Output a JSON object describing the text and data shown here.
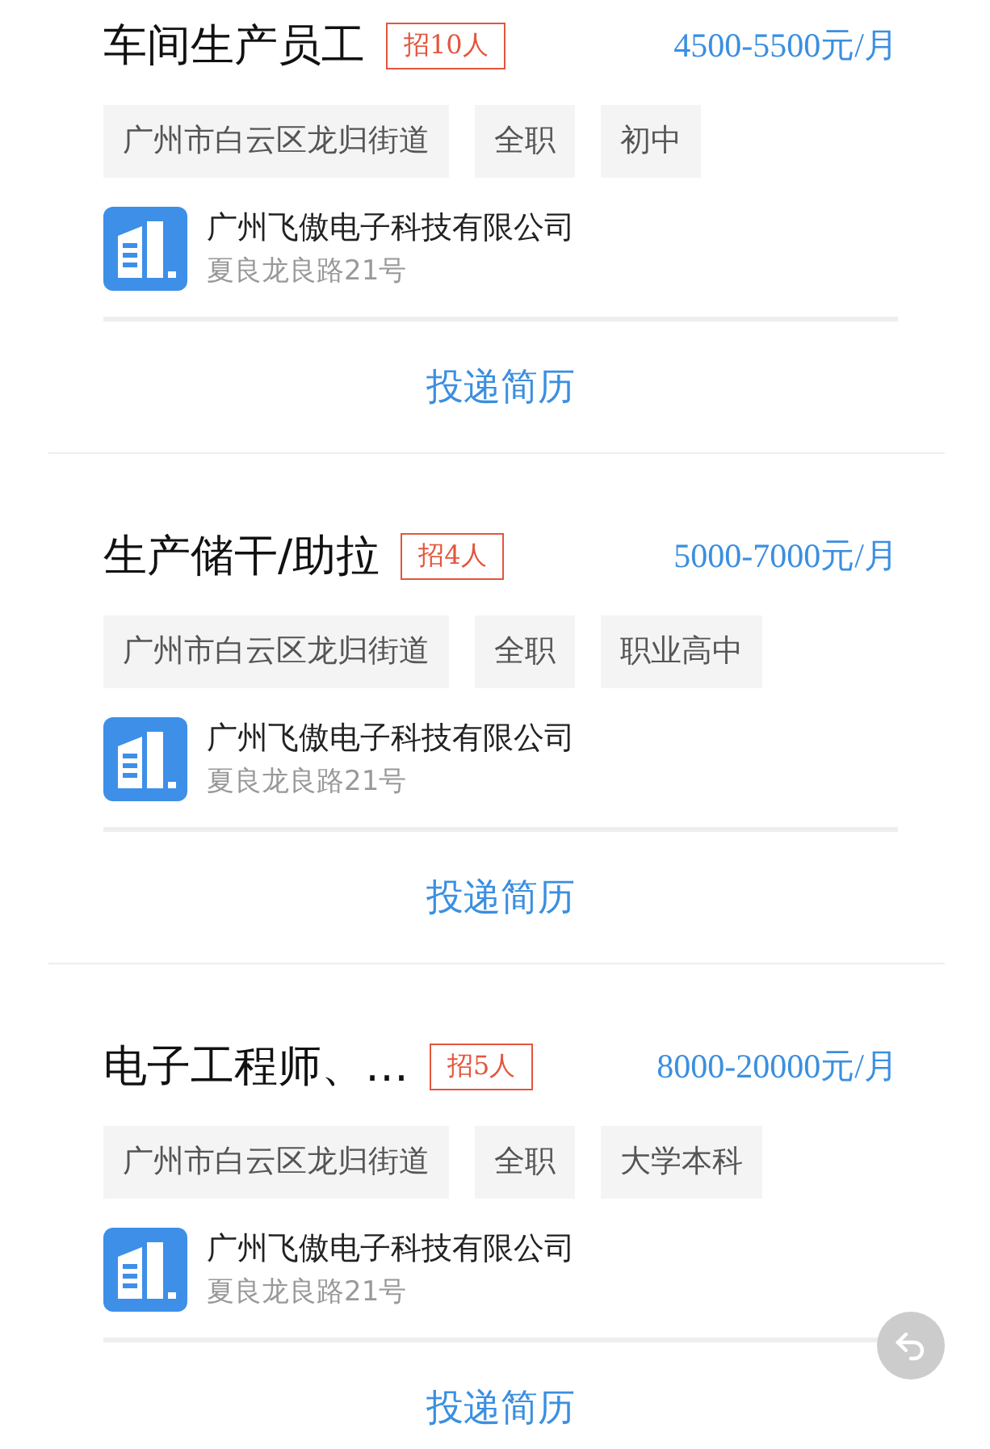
{
  "jobs": [
    {
      "title": "车间生产员工",
      "headcount": "招10人",
      "salary": "4500-5500元/月",
      "tags": [
        "广州市白云区龙归街道",
        "全职",
        "初中"
      ],
      "company": "广州飞傲电子科技有限公司",
      "address": "夏良龙良路21号",
      "action": "投递简历"
    },
    {
      "title": "生产储干/助拉",
      "headcount": "招4人",
      "salary": "5000-7000元/月",
      "tags": [
        "广州市白云区龙归街道",
        "全职",
        "职业高中"
      ],
      "company": "广州飞傲电子科技有限公司",
      "address": "夏良龙良路21号",
      "action": "投递简历"
    },
    {
      "title": "电子工程师、…",
      "headcount": "招5人",
      "salary": "8000-20000元/月",
      "tags": [
        "广州市白云区龙归街道",
        "全职",
        "大学本科"
      ],
      "company": "广州飞傲电子科技有限公司",
      "address": "夏良龙良路21号",
      "action": "投递简历"
    }
  ]
}
